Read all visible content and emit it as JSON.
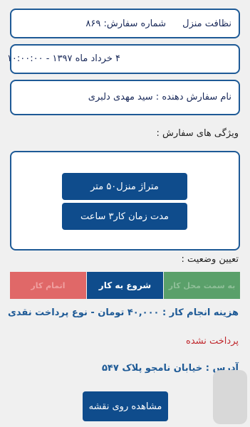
{
  "header": {
    "service": "نظافت منزل",
    "order_number": "شماره سفارش: ۸۶۹"
  },
  "date": {
    "text": "۴ خرداد ماه ۱۳۹۷ - ۱۰:۰۰:۰۰"
  },
  "customer": {
    "text": "نام سفارش دهنده : سید مهدی دلبری"
  },
  "features": {
    "title": "ویژگی های سفارش :",
    "items": [
      "متراژ منزل۵۰ متر",
      "مدت زمان کار۳ ساعت"
    ]
  },
  "status": {
    "title": "تعیین وضعیت :",
    "buttons": [
      "به سمت محل کار",
      "شروع به کار",
      "اتمام کار"
    ]
  },
  "cost": {
    "text": "هزینه انجام کار : ۴۰,۰۰۰ تومان - نوع پرداخت نقدی"
  },
  "payment": {
    "text": "پرداخت نشده"
  },
  "address": {
    "text": "آدرس : خیابان نامجو پلاک ۵۴۷"
  },
  "map_button": {
    "label": "مشاهده روی نقشه"
  },
  "colors": {
    "primary": "#0f4c8c",
    "border": "#1e5a96",
    "green": "#5aa06a",
    "red": "#e06868",
    "cost_text": "#1e5a96",
    "payment_text": "#c0282d"
  }
}
